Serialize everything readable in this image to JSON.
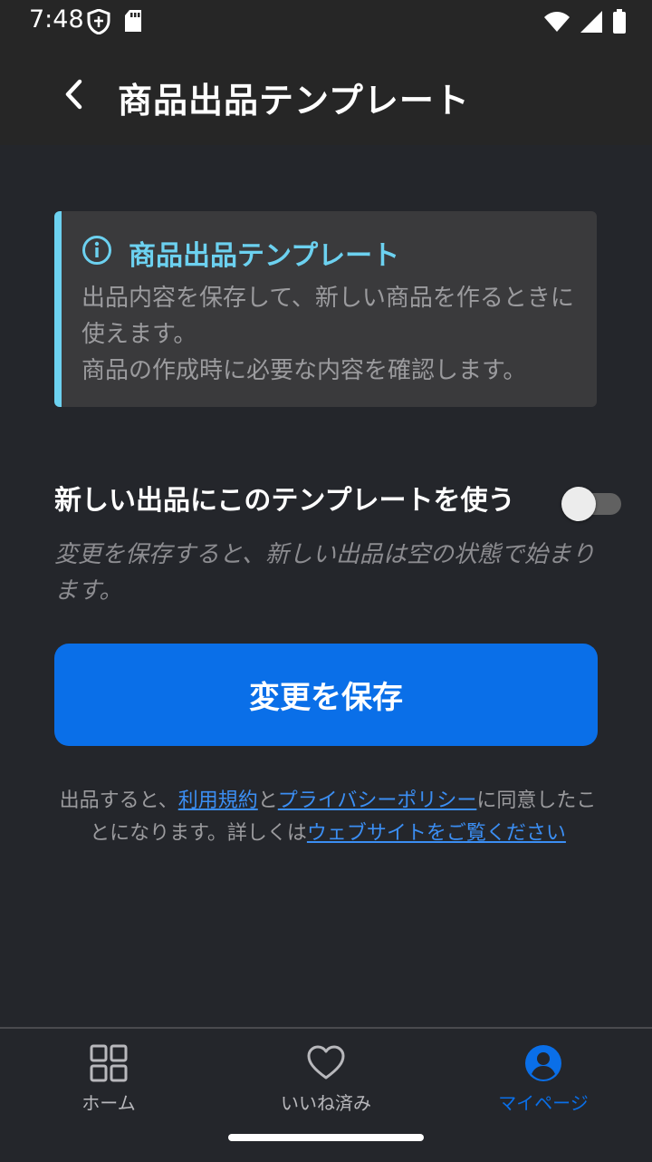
{
  "status": {
    "time": "7:48",
    "icons": [
      "shield-icon",
      "sd-card-icon",
      "wifi-icon",
      "signal-icon",
      "battery-icon"
    ]
  },
  "app_bar": {
    "title": "商品出品テンプレート",
    "back_icon": "chevron-left-icon"
  },
  "info": {
    "icon": "info-icon",
    "title": "商品出品テンプレート",
    "line1": "出品内容を保存して、新しい商品を作るときに使えます。",
    "line2": "商品の作成時に必要な内容を確認します。"
  },
  "toggle": {
    "label": "新しい出品にこのテンプレートを使う",
    "state": "off",
    "hint": "変更を保存すると、新しい出品は空の状態で始まります。"
  },
  "save_button": {
    "label": "変更を保存"
  },
  "terms": {
    "prefix": "出品すると、",
    "terms_link": "利用規約",
    "and": "と",
    "privacy_link": "プライバシーポリシー",
    "middle": "に同意したことになります。詳しくは",
    "website_link": "ウェブサイトをご覧ください"
  },
  "nav": {
    "items": [
      {
        "label": "ホーム",
        "icon": "grid-icon",
        "active": false
      },
      {
        "label": "いいね済み",
        "icon": "heart-icon",
        "active": false
      },
      {
        "label": "マイページ",
        "icon": "account-icon",
        "active": true
      }
    ]
  },
  "colors": {
    "background": "#24262b",
    "accent": "#6cd1f0",
    "primary": "#0a6fe8",
    "link": "#3b8ef3"
  }
}
